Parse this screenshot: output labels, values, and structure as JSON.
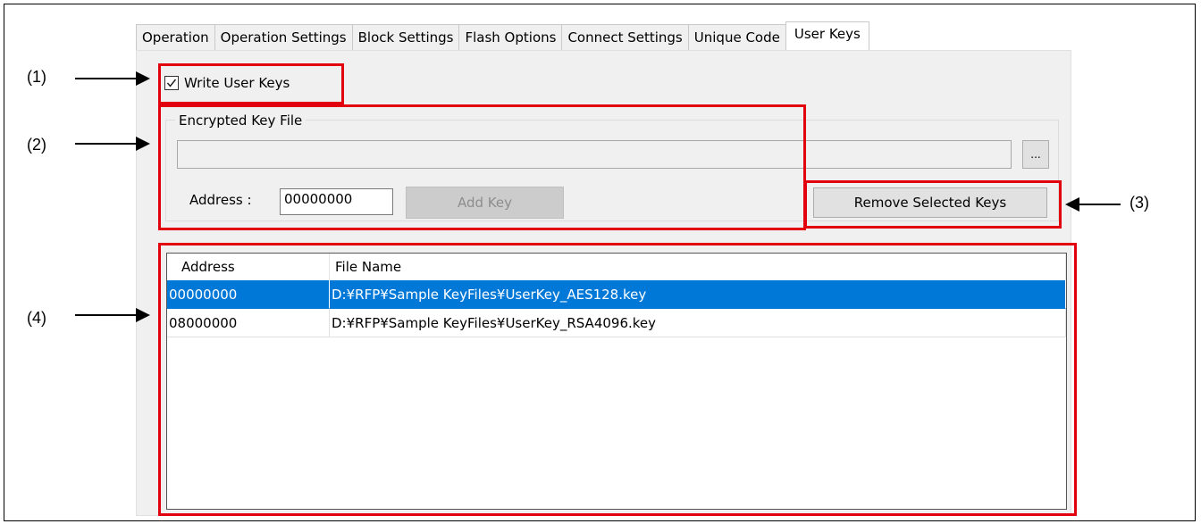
{
  "tabs": [
    {
      "label": "Operation",
      "active": false
    },
    {
      "label": "Operation Settings",
      "active": false
    },
    {
      "label": "Block Settings",
      "active": false
    },
    {
      "label": "Flash Options",
      "active": false
    },
    {
      "label": "Connect Settings",
      "active": false
    },
    {
      "label": "Unique Code",
      "active": false
    },
    {
      "label": "User Keys",
      "active": true
    }
  ],
  "write_user_keys": {
    "label": "Write User Keys",
    "checked": true
  },
  "encrypted_key_file": {
    "group_title": "Encrypted Key File",
    "file_path": "",
    "browse_label": "...",
    "address_label": "Address :",
    "address_value": "00000000",
    "add_key_label": "Add Key"
  },
  "remove_selected_keys_label": "Remove Selected Keys",
  "key_list": {
    "columns": [
      "Address",
      "File Name"
    ],
    "rows": [
      {
        "address": "00000000",
        "file": "D:¥RFP¥Sample KeyFiles¥UserKey_AES128.key",
        "selected": true
      },
      {
        "address": "08000000",
        "file": "D:¥RFP¥Sample KeyFiles¥UserKey_RSA4096.key",
        "selected": false
      }
    ]
  },
  "callouts": {
    "c1": "(1)",
    "c2": "(2)",
    "c3": "(3)",
    "c4": "(4)"
  },
  "colors": {
    "highlight_red": "#e2000f",
    "selection_blue": "#0078d7",
    "panel_gray": "#f0f0f0"
  }
}
